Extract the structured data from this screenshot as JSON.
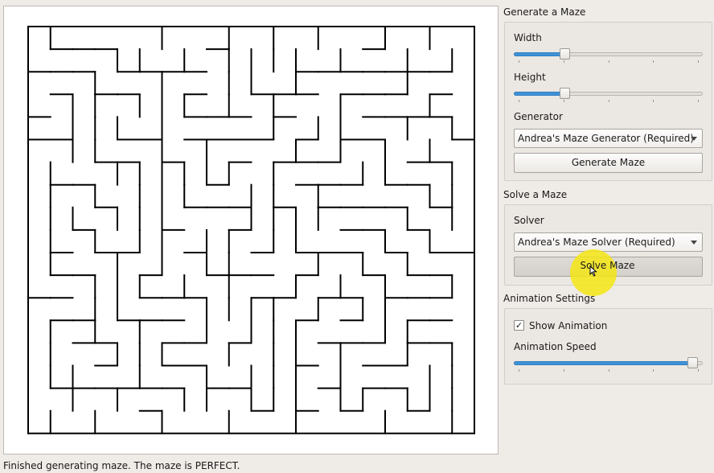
{
  "maze": {
    "cols": 20,
    "rows": 18,
    "wall_color": "#000000",
    "background": "#ffffff"
  },
  "generate": {
    "section_title": "Generate a Maze",
    "width_label": "Width",
    "width_fraction": 0.26,
    "height_label": "Height",
    "height_fraction": 0.26,
    "tick_count": 5,
    "generator_label": "Generator",
    "generator_value": "Andrea's Maze Generator (Required)",
    "button_label": "Generate Maze"
  },
  "solve": {
    "section_title": "Solve a Maze",
    "solver_label": "Solver",
    "solver_value": "Andrea's Maze Solver (Required)",
    "button_label": "Solve Maze"
  },
  "animation": {
    "section_title": "Animation Settings",
    "show_animation_label": "Show Animation",
    "show_animation_checked": true,
    "speed_label": "Animation Speed",
    "speed_fraction": 0.96,
    "tick_count": 5
  },
  "status": {
    "text": "Finished generating maze.  The maze is PERFECT."
  },
  "colors": {
    "accent": "#3f93d8",
    "cursor_highlight": "#f5e614"
  },
  "icons": {
    "checkbox": "check-icon",
    "dropdown": "chevron-down-icon",
    "cursor": "pointer-cursor-icon"
  }
}
